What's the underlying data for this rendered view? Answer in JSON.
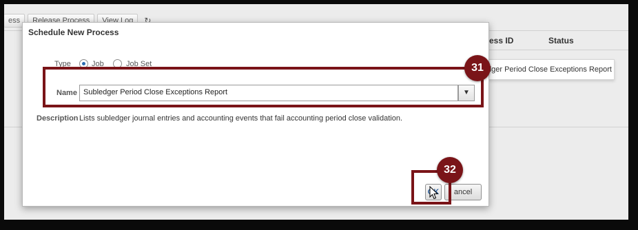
{
  "background": {
    "toolbar": {
      "buttons": [
        "ess",
        "Release Process",
        "View Log"
      ],
      "icon": "refresh-icon"
    },
    "table": {
      "headers": [
        "ocess ID",
        "Status"
      ]
    },
    "suggestion": "dger Period Close Exceptions Report"
  },
  "dialog": {
    "title": "Schedule New Process",
    "type_label": "Type",
    "type_options": [
      "Job",
      "Job Set"
    ],
    "type_selected": "Job",
    "name_label": "Name",
    "name_value": "Subledger Period Close Exceptions Report",
    "description_label": "Description",
    "description_text": "Lists subledger journal entries and accounting events that fail accounting period close validation.",
    "ok_label": "OK",
    "cancel_label": "ancel"
  },
  "annotations": {
    "step_31": "31",
    "step_32": "32",
    "highlight_color": "#7a1418"
  }
}
